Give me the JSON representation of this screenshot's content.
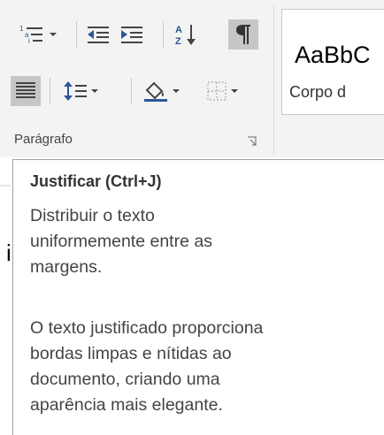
{
  "ribbon": {
    "group_label": "Parágrafo",
    "styles": {
      "sample": "AaBbC",
      "name": "Corpo d"
    },
    "buttons": {
      "multilevel_list": "multilevel-list-icon",
      "decrease_indent": "decrease-indent-icon",
      "increase_indent": "increase-indent-icon",
      "sort": "sort-az-icon",
      "show_marks": "pilcrow-icon",
      "justify": "justify-icon",
      "line_spacing": "line-spacing-icon",
      "shading": "paint-bucket-icon",
      "borders": "borders-icon",
      "launcher": "dialog-launcher-icon"
    }
  },
  "tooltip": {
    "title": "Justificar (Ctrl+J)",
    "para1_lines": [
      "Distribuir o texto",
      "uniformemente entre as",
      "margens."
    ],
    "para2_lines": [
      "O texto justificado proporciona",
      "bordas limpas e nítidas ao",
      "documento, criando uma",
      "aparência mais elegante."
    ]
  },
  "document": {
    "visible_char": "i"
  }
}
